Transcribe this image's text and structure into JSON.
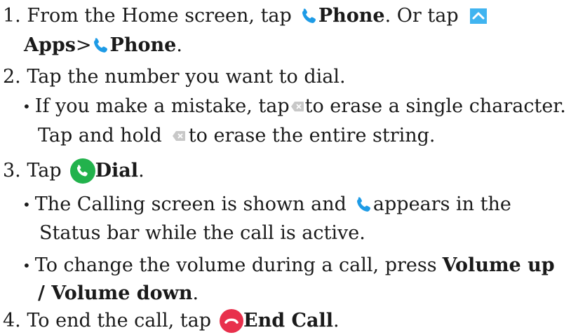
{
  "steps": {
    "s1": {
      "num": "1. From the Home screen, tap",
      "phone": "Phone",
      "mid": ". Or tap",
      "apps": "Apps",
      "gt": " >",
      "phone2": "Phone",
      "end": "."
    },
    "s2": {
      "text": "2. Tap the number you want to dial.",
      "b1a": "If you make a mistake, tap",
      "b1b": "to erase a single character.",
      "b1c": "Tap and hold",
      "b1d": "to erase the entire string."
    },
    "s3": {
      "num": "3. Tap",
      "dial": "Dial",
      "end": ".",
      "b1a": "The Calling screen is shown and",
      "b1b": "appears in the",
      "b1c": "Status bar while the call is active.",
      "b2a": "To change the volume during a call, press",
      "b2b": "Volume up",
      "b2c": "/ Volume down",
      "b2d": "."
    },
    "s4": {
      "num": "4. To end the call, tap",
      "endcall": "End Call",
      "end": "."
    }
  },
  "bullet_char": "•",
  "icons": {
    "phone": "phone-icon",
    "apps": "apps-chevron-up-icon",
    "backspace": "backspace-icon",
    "dial": "dial-icon",
    "end_call": "end-call-icon"
  },
  "colors": {
    "phone_blue": "#1e9be6",
    "apps_blue": "#40b4f0",
    "dial_green": "#22b24c",
    "end_red": "#e8304c",
    "backspace_gray": "#c8c8c8"
  }
}
